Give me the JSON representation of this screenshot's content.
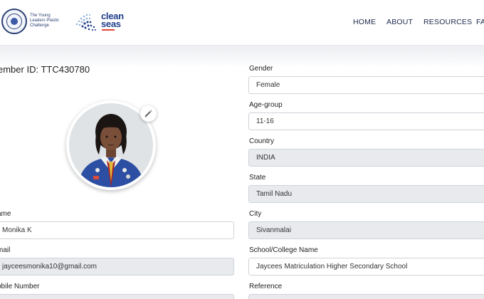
{
  "header": {
    "logo1_text": "The Young Leaders Plastic Challenge",
    "logo2_text_line1": "clean",
    "logo2_text_line2": "seas",
    "nav": [
      "HOME",
      "ABOUT",
      "RESOURCES",
      "FA"
    ]
  },
  "profile": {
    "member_id": "ember ID: TTC430780"
  },
  "left_fields": {
    "name_label": "ame",
    "name_value": "Monika K",
    "email_label": "mail",
    "email_value": "jayceesmonika10@gmail.com",
    "mobile_label": "obile Number"
  },
  "right_fields": {
    "gender_label": "Gender",
    "gender_value": "Female",
    "age_label": "Age-group",
    "age_value": "11-16",
    "country_label": "Country",
    "country_value": "INDIA",
    "state_label": "State",
    "state_value": "Tamil Nadu",
    "city_label": "City",
    "city_value": "Sivanmalai",
    "school_label": "School/College Name",
    "school_value": "Jaycees Matriculation Higher Secondary School",
    "reference_label": "Reference"
  },
  "colors": {
    "nav_text": "#1c2a4a",
    "brand_blue": "#1f3e8c",
    "readonly_bg": "#e8eaed"
  },
  "icons": {
    "edit": "pencil-icon"
  }
}
